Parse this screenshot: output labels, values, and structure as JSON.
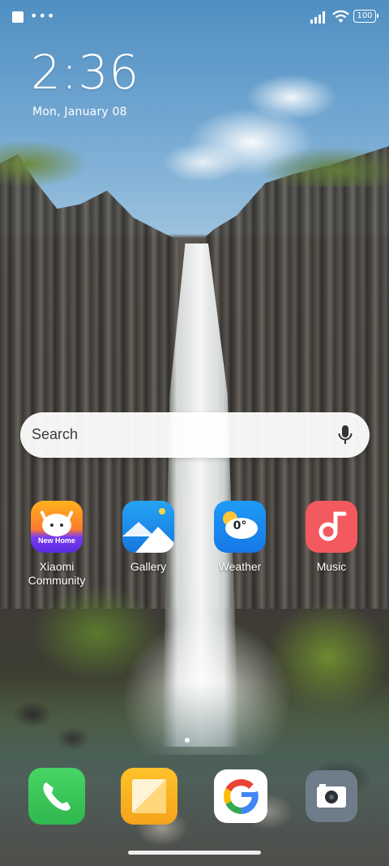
{
  "status_bar": {
    "notification_dots": "•••",
    "battery_level": "100"
  },
  "lock": {
    "time": "2:36",
    "date": "Mon, January 08"
  },
  "search": {
    "placeholder": "Search"
  },
  "apps": [
    {
      "label": "Xiaomi\nCommunity",
      "badge_text": "New Home",
      "icon": "xiaomi-community-icon"
    },
    {
      "label": "Gallery",
      "icon": "gallery-icon"
    },
    {
      "label": "Weather",
      "weather_temp": "0°",
      "icon": "weather-icon"
    },
    {
      "label": "Music",
      "icon": "music-icon"
    }
  ],
  "dock": [
    {
      "name": "Phone",
      "icon": "phone-icon"
    },
    {
      "name": "Notes",
      "icon": "notes-icon"
    },
    {
      "name": "Google",
      "icon": "google-icon"
    },
    {
      "name": "Camera",
      "icon": "camera-icon"
    }
  ],
  "colors": {
    "phone": "#3ec75a",
    "notes": "#f7b521",
    "music": "#f25a5f",
    "weather": "#1a8ef0",
    "gallery": "#2a9df4",
    "camera": "#6f7c89"
  }
}
